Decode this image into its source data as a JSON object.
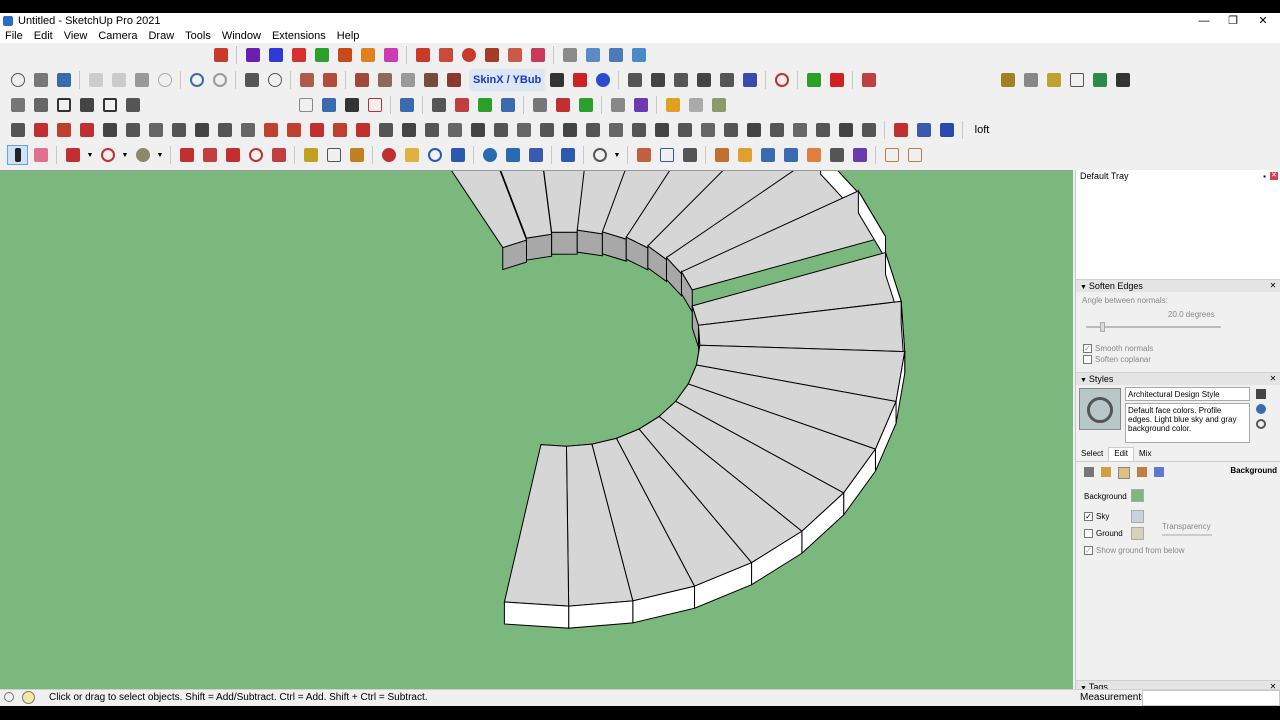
{
  "window": {
    "title": "Untitled - SketchUp Pro 2021",
    "minimize": "—",
    "maximize": "❐",
    "close": "✕"
  },
  "menu": [
    "File",
    "Edit",
    "View",
    "Camera",
    "Draw",
    "Tools",
    "Window",
    "Extensions",
    "Help"
  ],
  "toolbar": {
    "skin_label": "SkinX / YBub",
    "loft_label": "loft"
  },
  "tray": {
    "title": "Default Tray",
    "soften_edges": {
      "title": "Soften Edges",
      "angle_label": "Angle between normals:",
      "angle_value": "20.0  degrees",
      "smooth_normals": "Smooth normals",
      "soften_coplanar": "Soften coplanar"
    },
    "styles": {
      "title": "Styles",
      "style_name": "Architectural Design Style",
      "description": "Default face colors. Profile edges. Light blue sky and gray background color.",
      "tabs": [
        "Select",
        "Edit",
        "Mix"
      ],
      "section_label": "Background",
      "background_label": "Background",
      "sky_label": "Sky",
      "ground_label": "Ground",
      "transparency_label": "Transparency",
      "show_ground_label": "Show ground from below",
      "background_color": "#7ab87e",
      "sky_color": "#c9d3dc",
      "ground_color": "#d6d2ba"
    },
    "tags_title": "Tags"
  },
  "status": {
    "message": "Click or drag to select objects. Shift = Add/Subtract. Ctrl = Add. Shift + Ctrl = Subtract.",
    "measurements_label": "Measurements"
  }
}
